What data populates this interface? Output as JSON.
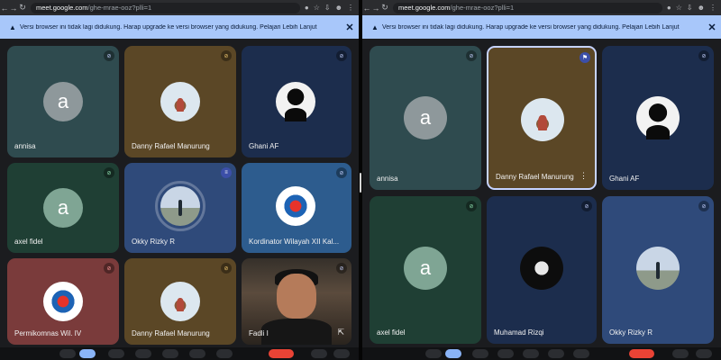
{
  "left": {
    "url_host": "meet.google.com",
    "url_path": "/ghe-mrae-ooz?plli=1",
    "banner": "Versi browser ini tidak lagi didukung. Harap upgrade ke versi browser yang didukung. Pelajari Lebih Lanjut",
    "participants": [
      {
        "name": "annisa"
      },
      {
        "name": "Danny Rafael Manurung"
      },
      {
        "name": "Ghani AF"
      },
      {
        "name": "axel fidel"
      },
      {
        "name": "Okky Rizky R"
      },
      {
        "name": "Kordinator Wilayah XII Kal..."
      },
      {
        "name": "Permikomnas Wil. IV"
      },
      {
        "name": "Danny Rafael Manurung"
      },
      {
        "name": "Fadli I"
      }
    ]
  },
  "right": {
    "url_host": "meet.google.com",
    "url_path": "/ghe-mrae-ooz?plli=1",
    "banner": "Versi browser ini tidak lagi didukung. Harap upgrade ke versi browser yang didukung. Pelajari Lebih Lanjut",
    "participants": [
      {
        "name": "annisa"
      },
      {
        "name": "Danny Rafael Manurung"
      },
      {
        "name": "Ghani AF"
      },
      {
        "name": "axel fidel"
      },
      {
        "name": "Muhamad Rizqi"
      },
      {
        "name": "Okky Rizky R"
      }
    ]
  },
  "avatar_letter": "a",
  "icons": {
    "mic_muted": "mic-off-icon",
    "speaking": "audio-wave-icon",
    "pin": "pin-icon",
    "close": "close-icon",
    "warning": "warning-icon"
  },
  "colors": {
    "banner_bg": "#a8c7fa",
    "tile_teal": "#2f4b4f",
    "tile_brown": "#5b4726",
    "tile_navy": "#1c2d4d",
    "tile_green": "#1f3f34",
    "tile_blue": "#2f4a7a",
    "tile_red": "#7a3b3b",
    "end_call": "#ea4335"
  }
}
